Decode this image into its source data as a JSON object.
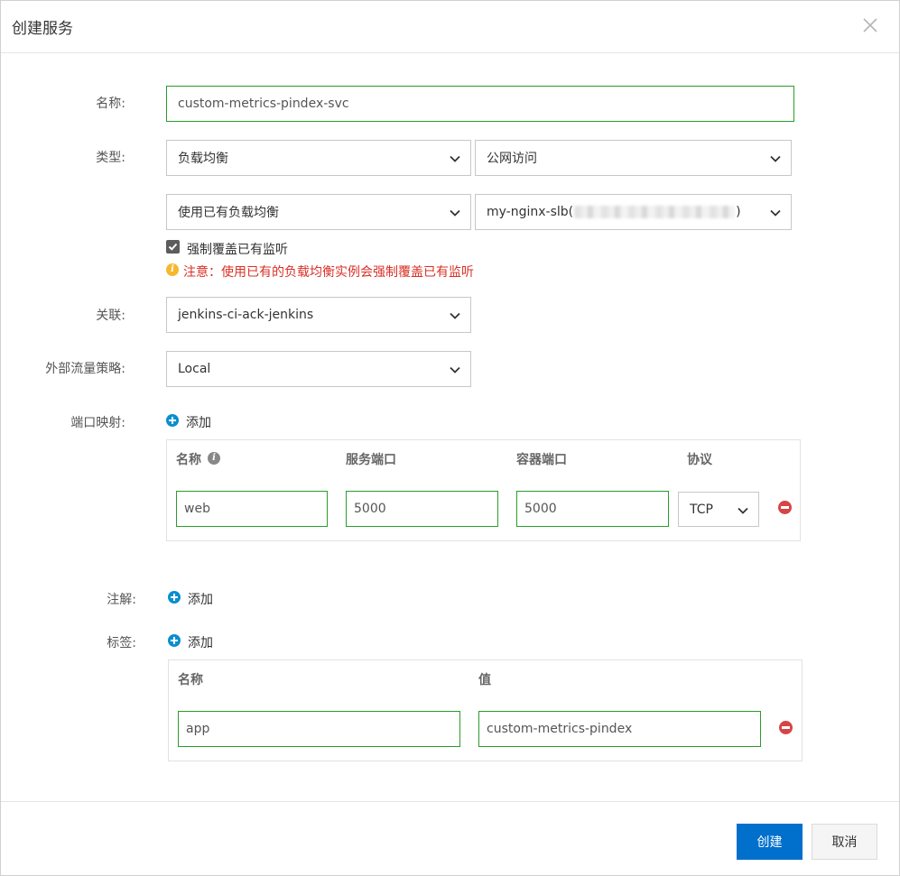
{
  "dialog": {
    "title": "创建服务"
  },
  "form": {
    "name": {
      "label": "名称:",
      "value": "custom-metrics-pindex-svc"
    },
    "type": {
      "label": "类型:",
      "service_type": "负载均衡",
      "access": "公网访问",
      "slb_mode": "使用已有负载均衡",
      "slb_instance_prefix": "my-nginx-slb(",
      "slb_instance_suffix": ")",
      "override_checkbox_label": "强制覆盖已有监听",
      "override_checked": true,
      "warning": "注意：使用已有的负载均衡实例会强制覆盖已有监听"
    },
    "association": {
      "label": "关联:",
      "value": "jenkins-ci-ack-jenkins"
    },
    "traffic_policy": {
      "label": "外部流量策略:",
      "value": "Local"
    },
    "port_mapping": {
      "label": "端口映射:",
      "add_label": "添加",
      "headers": {
        "name": "名称",
        "service_port": "服务端口",
        "container_port": "容器端口",
        "protocol": "协议"
      },
      "rows": [
        {
          "name": "web",
          "service_port": "5000",
          "container_port": "5000",
          "protocol": "TCP"
        }
      ]
    },
    "annotations": {
      "label": "注解:",
      "add_label": "添加"
    },
    "labels": {
      "label": "标签:",
      "add_label": "添加",
      "headers": {
        "name": "名称",
        "value": "值"
      },
      "rows": [
        {
          "name": "app",
          "value": "custom-metrics-pindex"
        }
      ]
    }
  },
  "footer": {
    "create_label": "创建",
    "cancel_label": "取消"
  },
  "colors": {
    "primary": "#0070cc",
    "valid_border": "#2a9d2a",
    "warning_text": "#d93026",
    "add_icon": "#0a8ecf",
    "remove_icon": "#d64545"
  }
}
